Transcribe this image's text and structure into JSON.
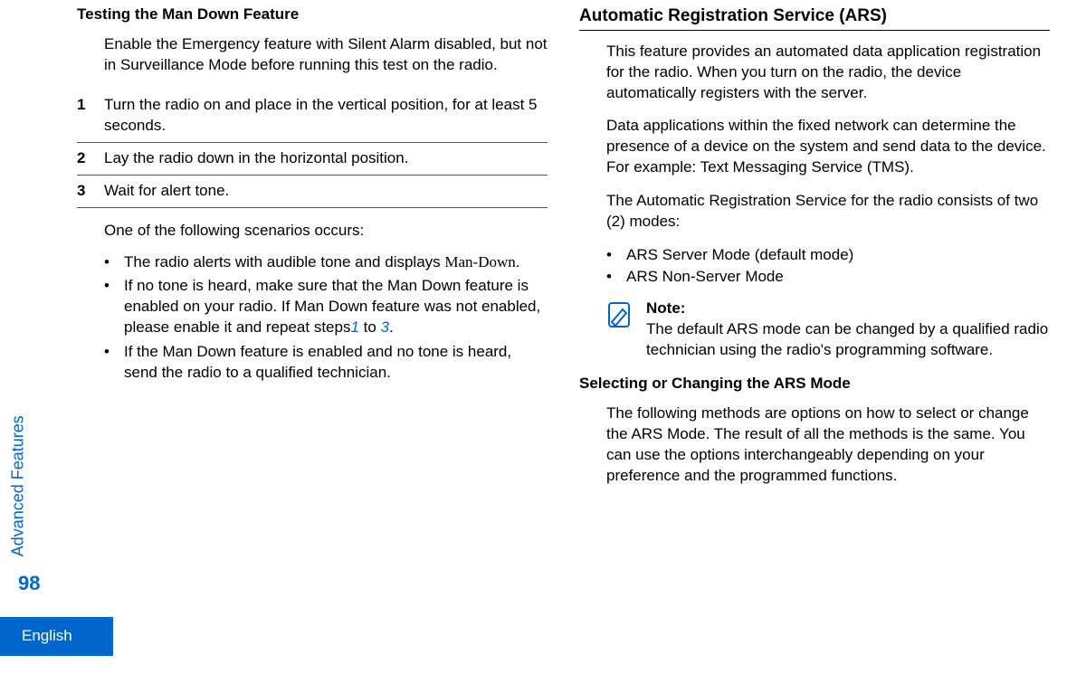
{
  "sidebar": {
    "section": "Advanced Features",
    "pageNumber": "98",
    "language": "English"
  },
  "left": {
    "title": "Testing the Man Down Feature",
    "intro": "Enable the Emergency feature with Silent Alarm disabled, but not in Surveillance Mode before running this test on the radio.",
    "steps": [
      "Turn the radio on and place in the vertical position, for at least 5 seconds.",
      "Lay the radio down in the horizontal position.",
      "Wait for alert tone."
    ],
    "postStepsText": "One of the following scenarios occurs:",
    "scenarios": {
      "s1_prefix": "The radio alerts with audible tone and displays ",
      "s1_mono": "Man-Down",
      "s1_suffix": ".",
      "s2_a": "If no tone is heard, make sure that the Man Down feature is enabled on your radio. If Man Down feature was not enabled, please enable it and repeat steps",
      "s2_link1": "1",
      "s2_mid": " to ",
      "s2_link3": "3",
      "s2_end": ".",
      "s3": "If the Man Down feature is enabled and no tone is heard, send the radio to a qualified technician."
    }
  },
  "right": {
    "header": "Automatic Registration Service (ARS)",
    "p1": "This feature provides an automated data application registration for the radio. When you turn on the radio, the device automatically registers with the server.",
    "p2": "Data applications within the fixed network can determine the presence of a device on the system and send data to the device. For example: Text Messaging Service (TMS).",
    "p3": "The Automatic Registration Service for the radio consists of two (2) modes:",
    "modes": [
      "ARS Server Mode (default mode)",
      "ARS Non-Server Mode"
    ],
    "noteTitle": "Note:",
    "noteBody": "The default ARS mode can be changed by a qualified radio technician using the radio's programming software.",
    "subTitle": "Selecting or Changing the ARS Mode",
    "subPara": "The following methods are options on how to select or change the ARS Mode. The result of all the methods is the same. You can use the options interchangeably depending on your preference and the programmed functions."
  }
}
